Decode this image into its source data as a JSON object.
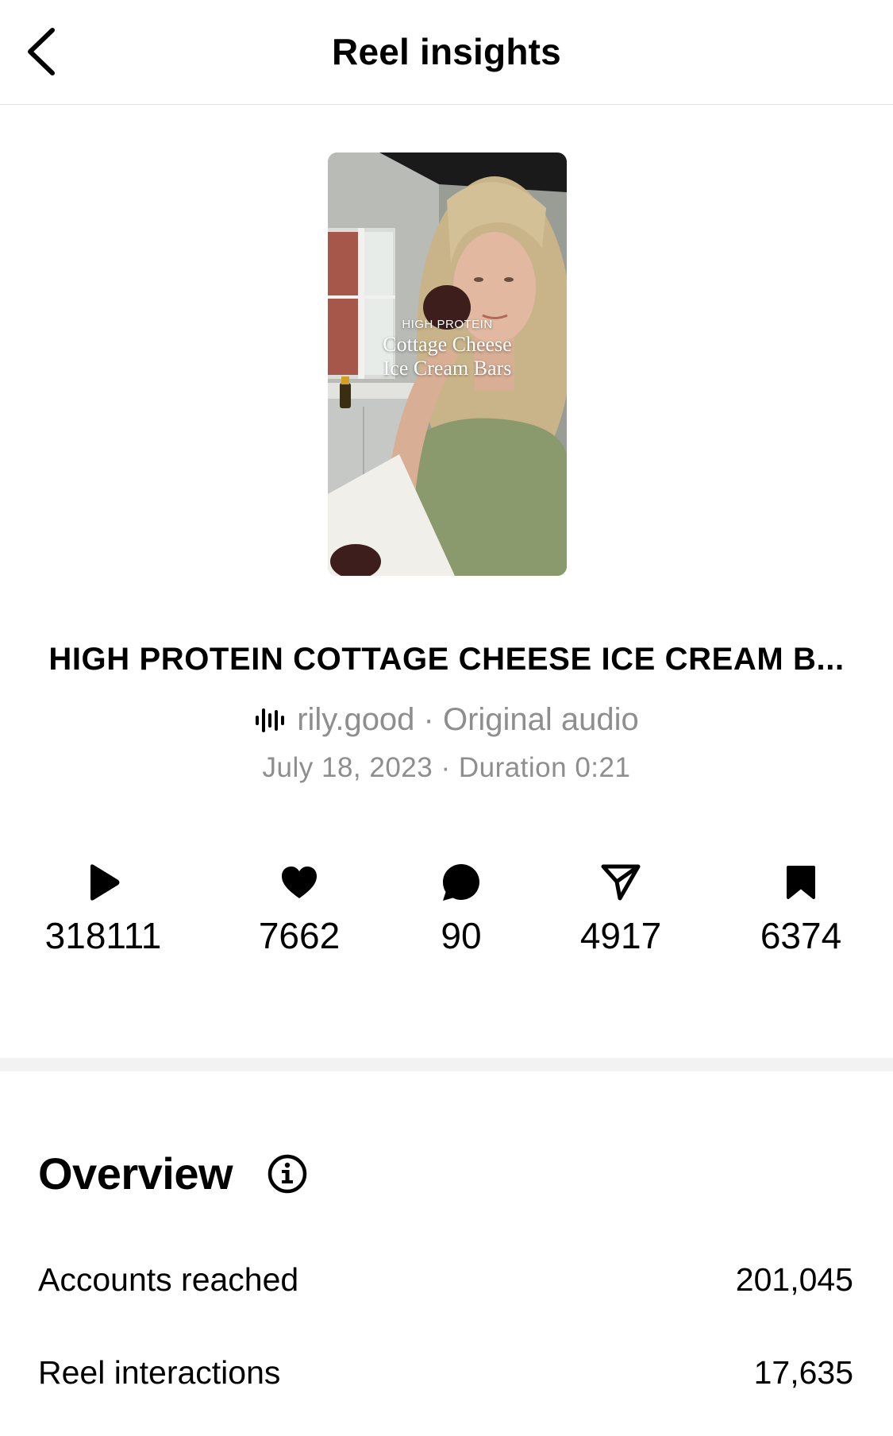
{
  "header": {
    "title": "Reel insights",
    "back_icon": "chevron-left-icon"
  },
  "reel": {
    "thumbnail_text": {
      "line1": "HIGH PROTEIN",
      "line2": "Cottage Cheese",
      "line3": "Ice Cream Bars"
    },
    "title": "HIGH PROTEIN COTTAGE CHEESE ICE CREAM B...",
    "audio_icon": "audio-waveform-icon",
    "audio_label": "rily.good · Original audio",
    "meta": "July 18, 2023 · Duration 0:21"
  },
  "stats": {
    "plays": {
      "icon": "play-icon",
      "value": "318111"
    },
    "likes": {
      "icon": "heart-icon",
      "value": "7662"
    },
    "comments": {
      "icon": "comment-icon",
      "value": "90"
    },
    "shares": {
      "icon": "send-icon",
      "value": "4917"
    },
    "saves": {
      "icon": "bookmark-icon",
      "value": "6374"
    }
  },
  "overview": {
    "title": "Overview",
    "info_icon": "info-icon",
    "rows": [
      {
        "label": "Accounts reached",
        "value": "201,045"
      },
      {
        "label": "Reel interactions",
        "value": "17,635"
      }
    ]
  },
  "colors": {
    "text_primary": "#000000",
    "text_secondary": "#8e8e8e",
    "divider": "#f2f2f2",
    "background": "#ffffff"
  }
}
